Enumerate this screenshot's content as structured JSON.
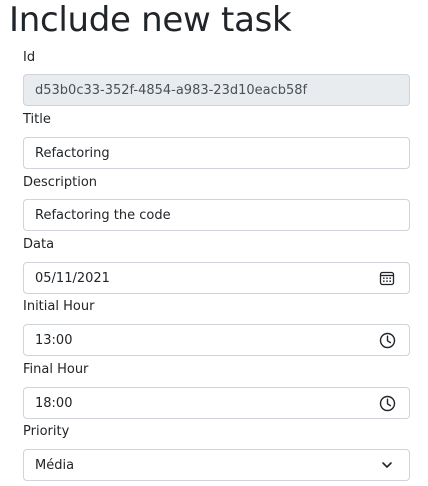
{
  "page": {
    "title": "Include new task"
  },
  "form": {
    "id": {
      "label": "Id",
      "value": "d53b0c33-352f-4854-a983-23d10eacb58f"
    },
    "title": {
      "label": "Title",
      "value": "Refactoring"
    },
    "description": {
      "label": "Description",
      "value": "Refactoring the code"
    },
    "date": {
      "label": "Data",
      "value": "05/11/2021",
      "icon": "calendar-icon"
    },
    "initial_hour": {
      "label": "Initial Hour",
      "value": "13:00",
      "icon": "clock-icon"
    },
    "final_hour": {
      "label": "Final Hour",
      "value": "18:00",
      "icon": "clock-icon"
    },
    "priority": {
      "label": "Priority",
      "value": "Média",
      "icon": "chevron-down-icon"
    }
  },
  "colors": {
    "text": "#212529",
    "border": "#ced4da",
    "readonly_background": "#e9ecef"
  }
}
